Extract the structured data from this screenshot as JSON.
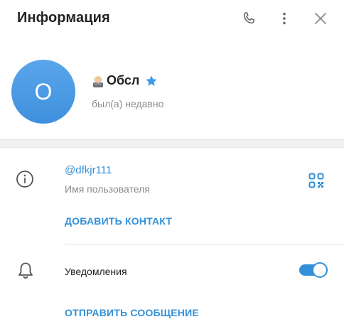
{
  "header": {
    "title": "Информация",
    "icons": {
      "phone": "phone-icon",
      "more": "more-vertical-icon",
      "close": "close-icon"
    }
  },
  "profile": {
    "avatar_letter": "О",
    "avatar_color": "#4a9ae4",
    "name": "Обсл",
    "status": "был(а) недавно",
    "badges": {
      "emoji": "person-emoji-icon",
      "premium": "premium-star-icon"
    }
  },
  "info": {
    "username": "@dfkjr111",
    "username_caption": "Имя пользователя",
    "add_contact_label": "ДОБАВИТЬ КОНТАКТ",
    "icons": {
      "info": "info-icon",
      "qr": "qr-code-icon"
    }
  },
  "notifications": {
    "label": "Уведомления",
    "enabled": true,
    "send_message_label": "ОТПРАВИТЬ СООБЩЕНИЕ",
    "icons": {
      "bell": "bell-icon"
    }
  },
  "colors": {
    "accent": "#3390d8",
    "secondary_text": "#8e8e8e"
  }
}
